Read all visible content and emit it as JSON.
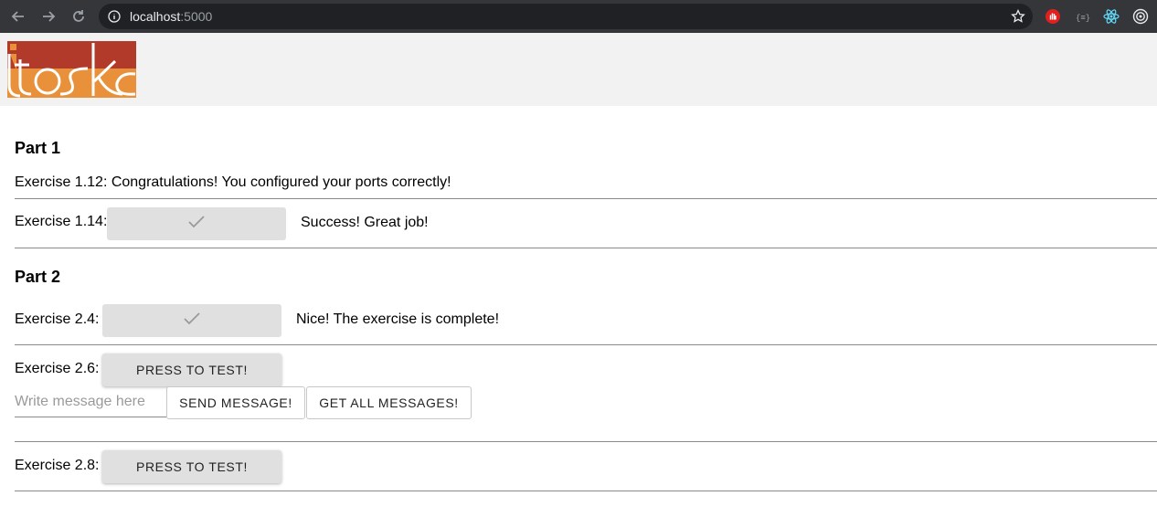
{
  "browser": {
    "url_host": "localhost",
    "url_port": ":5000"
  },
  "logo": {
    "text": "itoska"
  },
  "part1": {
    "heading": "Part 1",
    "ex112": {
      "text": "Exercise 1.12: Congratulations! You configured your ports correctly!"
    },
    "ex114": {
      "label": "Exercise 1.14:",
      "result": "Success! Great job!"
    }
  },
  "part2": {
    "heading": "Part 2",
    "ex24": {
      "label": "Exercise 2.4:",
      "result": "Nice! The exercise is complete!"
    },
    "ex26": {
      "label": "Exercise 2.6:",
      "button": "PRESS TO TEST!",
      "input_placeholder": "Write message here",
      "send_button": "SEND MESSAGE!",
      "get_button": "GET ALL MESSAGES!"
    },
    "ex28": {
      "label": "Exercise 2.8:",
      "button": "PRESS TO TEST!"
    }
  },
  "colors": {
    "logo_red": "#b23a2b",
    "logo_orange": "#e8913a",
    "button_grey": "#e0e0e0"
  }
}
